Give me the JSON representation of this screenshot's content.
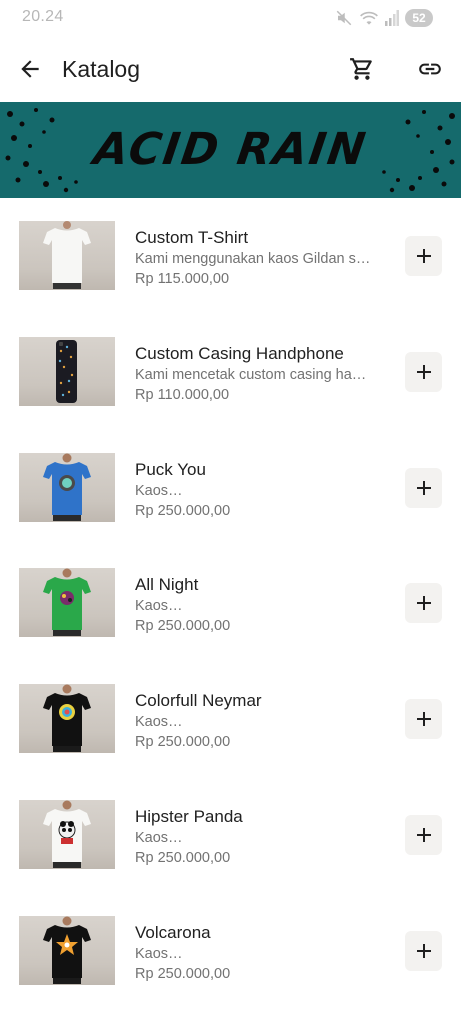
{
  "status_bar": {
    "time": "20.24",
    "battery": "52",
    "icons": [
      "mute-icon",
      "wifi-icon",
      "signal-icon",
      "battery-icon"
    ]
  },
  "app_bar": {
    "title": "Katalog",
    "icons": [
      "arrow-back-icon",
      "cart-icon",
      "link-icon"
    ]
  },
  "banner": {
    "text": "ACID RAIN",
    "background": "#156a6c"
  },
  "products": [
    {
      "name": "Custom T-Shirt",
      "description": "Kami menggunakan kaos Gildan s…",
      "price": "Rp 115.000,00",
      "thumb": "white-tshirt"
    },
    {
      "name": "Custom Casing Handphone",
      "description": "Kami mencetak custom casing ha…",
      "price": "Rp 110.000,00",
      "thumb": "phone-case"
    },
    {
      "name": "Puck You",
      "description": "Kaos…",
      "price": "Rp 250.000,00",
      "thumb": "blue-tshirt"
    },
    {
      "name": "All Night",
      "description": "Kaos…",
      "price": "Rp 250.000,00",
      "thumb": "green-tshirt"
    },
    {
      "name": "Colorfull Neymar",
      "description": "Kaos…",
      "price": "Rp 250.000,00",
      "thumb": "black-tshirt"
    },
    {
      "name": "Hipster Panda",
      "description": "Kaos…",
      "price": "Rp 250.000,00",
      "thumb": "white-panda-tshirt"
    },
    {
      "name": "Volcarona",
      "description": "Kaos…",
      "price": "Rp 250.000,00",
      "thumb": "black-star-tshirt"
    }
  ],
  "add_button_icon": "plus-icon"
}
